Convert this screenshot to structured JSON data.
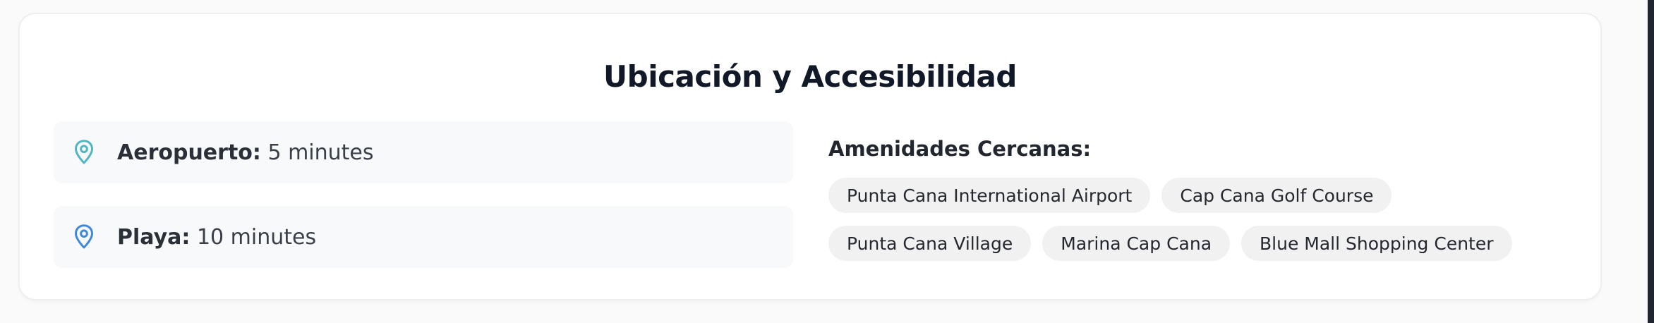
{
  "section": {
    "title": "Ubicación y Accesibilidad"
  },
  "locations": [
    {
      "label": "Aeropuerto:",
      "value": "5 minutes",
      "icon": "map-pin-icon",
      "color": "#4fb6c2"
    },
    {
      "label": "Playa:",
      "value": "10 minutes",
      "icon": "map-pin-icon",
      "color": "#3f88dc"
    }
  ],
  "amenities": {
    "title": "Amenidades Cercanas:",
    "items": [
      "Punta Cana International Airport",
      "Cap Cana Golf Course",
      "Punta Cana Village",
      "Marina Cap Cana",
      "Blue Mall Shopping Center"
    ]
  }
}
